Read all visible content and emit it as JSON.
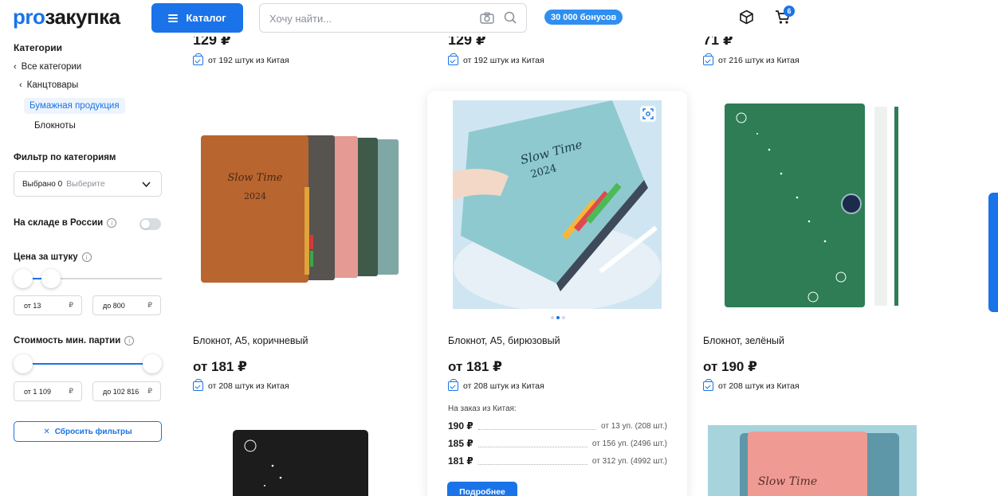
{
  "header": {
    "logo_pro": "pro",
    "logo_rest": "закупка",
    "catalog_label": "Каталог",
    "search_placeholder": "Хочу найти...",
    "bonus_label": "30 000 бонусов",
    "cart_count": "6"
  },
  "sidebar": {
    "title": "Категории",
    "crumbs": [
      "Все категории",
      "Канцтовары"
    ],
    "active_crumb": "Бумажная продукция",
    "leaf": "Блокноты",
    "filter_title": "Фильтр по категориям",
    "select_count": "Выбрано 0",
    "select_placeholder": "Выберите",
    "stock_label": "На складе в России",
    "price_label": "Цена за штуку",
    "price_from": "от 13",
    "price_to": "до 800",
    "cost_label": "Стоимость мин. партии",
    "cost_from": "от 1 109",
    "cost_to": "до 102 816",
    "currency": "₽",
    "reset_label": "Сбросить фильтры"
  },
  "top_row": [
    {
      "price": "129 ₽",
      "ship": "от 192 штук из Китая"
    },
    {
      "price": "129 ₽",
      "ship": "от 192 штук из Китая"
    },
    {
      "price": "71 ₽",
      "ship": "от 216 штук из Китая"
    }
  ],
  "products": [
    {
      "name": "Блокнот, А5, коричневый",
      "price": "от 181 ₽",
      "ship": "от 208 штук из Китая"
    },
    {
      "name": "Блокнот, А5, бирюзовый",
      "price": "от 181 ₽",
      "ship": "от 208 штук из Китая"
    },
    {
      "name": "Блокнот, зелёный",
      "price": "от 190 ₽",
      "ship": "от 208 штук из Китая"
    }
  ],
  "order": {
    "title": "На заказ из Китая:",
    "tiers": [
      {
        "price": "190 ₽",
        "qty": "от 13 уп. (208 шт.)"
      },
      {
        "price": "185 ₽",
        "qty": "от 156 уп. (2496 шт.)"
      },
      {
        "price": "181 ₽",
        "qty": "от 312 уп. (4992 шт.)"
      }
    ],
    "more_label": "Подробнее"
  },
  "cover_text": {
    "brand": "Slow Time",
    "year": "2024"
  },
  "colors": {
    "accent": "#1a73e8",
    "brown": "#b8652f",
    "turquoise": "#7fc4c9",
    "green": "#2e7d54",
    "pink": "#ec9a93"
  }
}
